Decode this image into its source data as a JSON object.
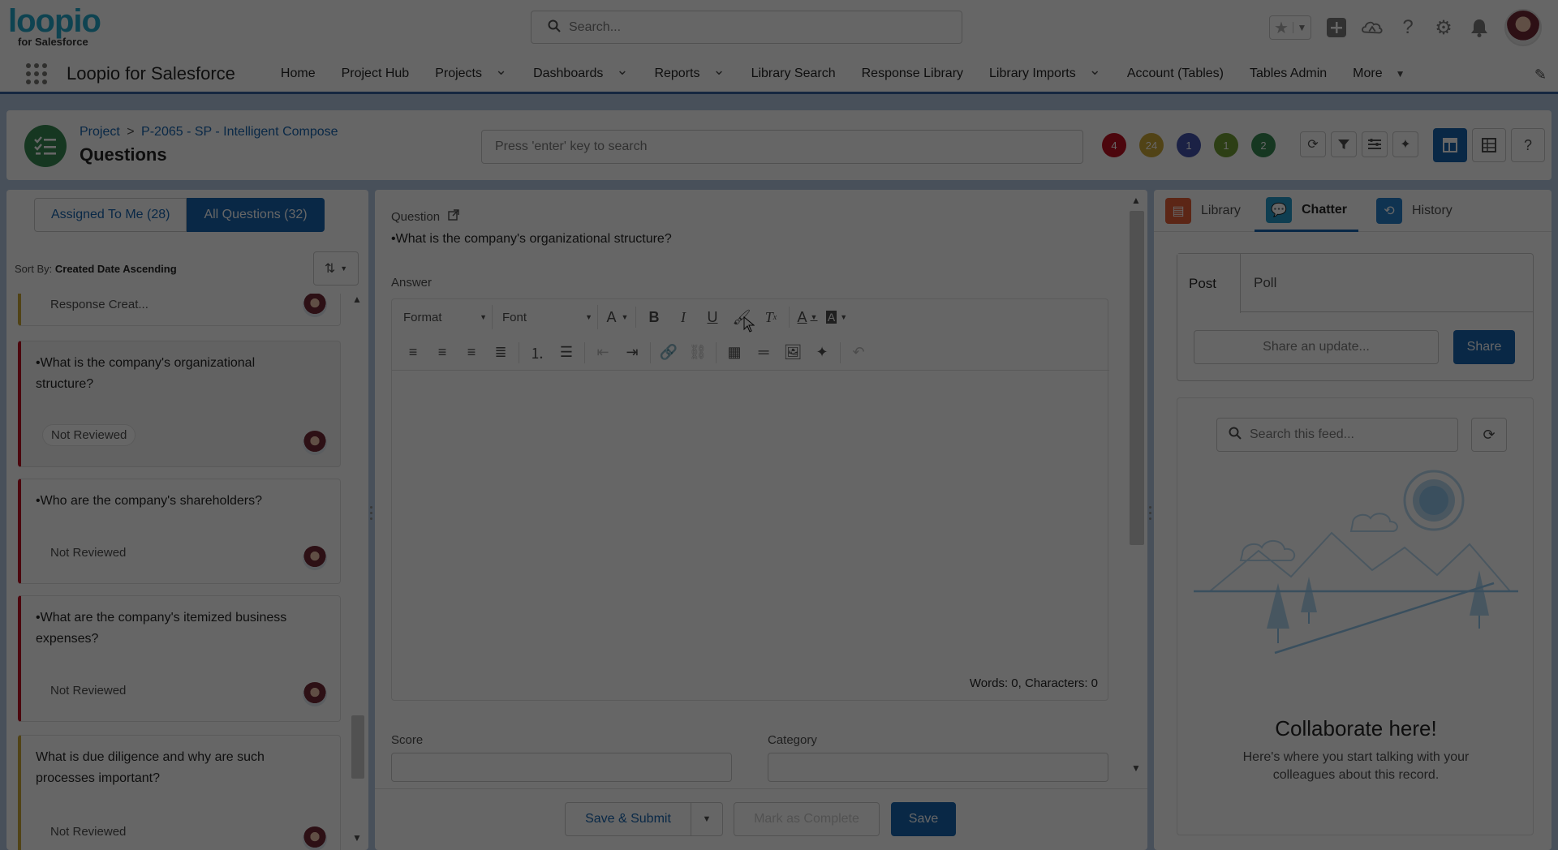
{
  "brand": {
    "logo_word": "loopio",
    "logo_sub": "for Salesforce"
  },
  "global_header": {
    "search_placeholder": "Search..."
  },
  "nav": {
    "app_name": "Loopio for Salesforce",
    "items": [
      {
        "label": "Home",
        "has_menu": false
      },
      {
        "label": "Project Hub",
        "has_menu": false
      },
      {
        "label": "Projects",
        "has_menu": true
      },
      {
        "label": "Dashboards",
        "has_menu": true
      },
      {
        "label": "Reports",
        "has_menu": true
      },
      {
        "label": "Library Search",
        "has_menu": false
      },
      {
        "label": "Response Library",
        "has_menu": false
      },
      {
        "label": "Library Imports",
        "has_menu": true
      },
      {
        "label": "Account (Tables)",
        "has_menu": false
      },
      {
        "label": "Tables Admin",
        "has_menu": false
      }
    ],
    "more_label": "More"
  },
  "page_header": {
    "breadcrumb_root": "Project",
    "breadcrumb_sep": ">",
    "breadcrumb_project": "P-2065 - SP - Intelligent Compose",
    "title": "Questions",
    "search_placeholder": "Press 'enter' key to search",
    "badges": [
      {
        "count": "4",
        "color": "#ba0517"
      },
      {
        "count": "24",
        "color": "#c9a32e"
      },
      {
        "count": "1",
        "color": "#3a4aa8"
      },
      {
        "count": "1",
        "color": "#6b9a2a"
      },
      {
        "count": "2",
        "color": "#2e844a"
      }
    ]
  },
  "left_panel": {
    "assigned_label": "Assigned To Me (28)",
    "all_label": "All Questions (32)",
    "sort_prefix": "Sort By:",
    "sort_value": "Created Date Ascending",
    "partial_card_status": "Response Creat...",
    "questions": [
      {
        "text": "•What is the company's organizational structure?",
        "status": "Not Reviewed"
      },
      {
        "text": "•Who are the company's shareholders?",
        "status": "Not Reviewed"
      },
      {
        "text": "•What are the company's itemized business expenses?",
        "status": "Not Reviewed"
      },
      {
        "text": "What is due diligence and why are such processes important?",
        "status": "Not Reviewed"
      }
    ]
  },
  "center_panel": {
    "question_label": "Question",
    "question_text": "•What is the company's organizational structure?",
    "answer_label": "Answer",
    "format_label": "Format",
    "font_label": "Font",
    "word_count": "Words: 0, Characters: 0",
    "score_label": "Score",
    "category_label": "Category",
    "save_submit_label": "Save & Submit",
    "mark_complete_label": "Mark as Complete",
    "save_label": "Save"
  },
  "right_panel": {
    "tabs": [
      {
        "label": "Library",
        "icon": "book-icon",
        "color": "#e4572e"
      },
      {
        "label": "Chatter",
        "icon": "chat-icon",
        "color": "#1b96c9"
      },
      {
        "label": "History",
        "icon": "history-icon",
        "color": "#1b7ac9"
      }
    ],
    "post_label": "Post",
    "poll_label": "Poll",
    "share_placeholder": "Share an update...",
    "share_label": "Share",
    "feed_search_placeholder": "Search this feed...",
    "collab_title": "Collaborate here!",
    "collab_text": "Here's where you start talking with your colleagues about this record."
  }
}
